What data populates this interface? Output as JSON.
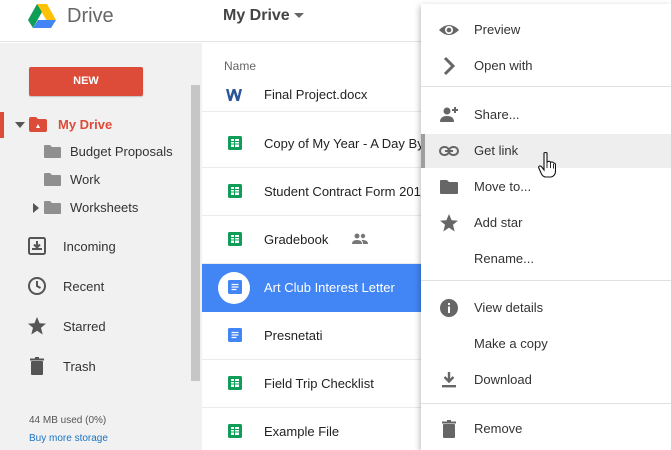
{
  "app": {
    "name": "Drive",
    "current_folder": "My Drive"
  },
  "sidebar": {
    "new_label": "NEW",
    "tree": [
      {
        "label": "My Drive",
        "active": true
      },
      {
        "label": "Budget Proposals"
      },
      {
        "label": "Work"
      },
      {
        "label": "Worksheets"
      }
    ],
    "nav": [
      {
        "label": "Incoming",
        "icon": "incoming-icon"
      },
      {
        "label": "Recent",
        "icon": "clock-icon"
      },
      {
        "label": "Starred",
        "icon": "star-icon"
      },
      {
        "label": "Trash",
        "icon": "trash-icon"
      }
    ],
    "storage_used": "44 MB used (0%)",
    "buy_storage": "Buy more storage"
  },
  "list": {
    "column_name": "Name",
    "files": [
      {
        "name": "Final Project.docx",
        "type": "word"
      },
      {
        "name": "Copy of My Year - A Day By",
        "type": "sheet"
      },
      {
        "name": "Student Contract Form 201",
        "type": "sheet"
      },
      {
        "name": "Gradebook",
        "type": "sheet",
        "shared": true
      },
      {
        "name": "Art Club Interest Letter",
        "type": "doc",
        "selected": true
      },
      {
        "name": "Presnetati",
        "type": "doc"
      },
      {
        "name": "Field Trip Checklist",
        "type": "sheet"
      },
      {
        "name": "Example File",
        "type": "sheet"
      }
    ]
  },
  "context_menu": {
    "items": [
      {
        "label": "Preview",
        "icon": "eye-icon"
      },
      {
        "label": "Open with",
        "icon": "",
        "submenu": true
      },
      {
        "label": "Share...",
        "icon": "add-person-icon"
      },
      {
        "label": "Get link",
        "icon": "link-icon",
        "hover": true
      },
      {
        "label": "Move to...",
        "icon": "folder-icon"
      },
      {
        "label": "Add star",
        "icon": "star-icon"
      },
      {
        "label": "Rename...",
        "icon": ""
      },
      {
        "label": "View details",
        "icon": "info-icon"
      },
      {
        "label": "Make a copy",
        "icon": ""
      },
      {
        "label": "Download",
        "icon": "download-icon"
      },
      {
        "label": "Remove",
        "icon": "trash-icon"
      }
    ]
  },
  "colors": {
    "accent": "#dd4b39",
    "selection": "#4285f4",
    "sheet_green": "#0f9d58",
    "doc_blue": "#4285f4"
  }
}
